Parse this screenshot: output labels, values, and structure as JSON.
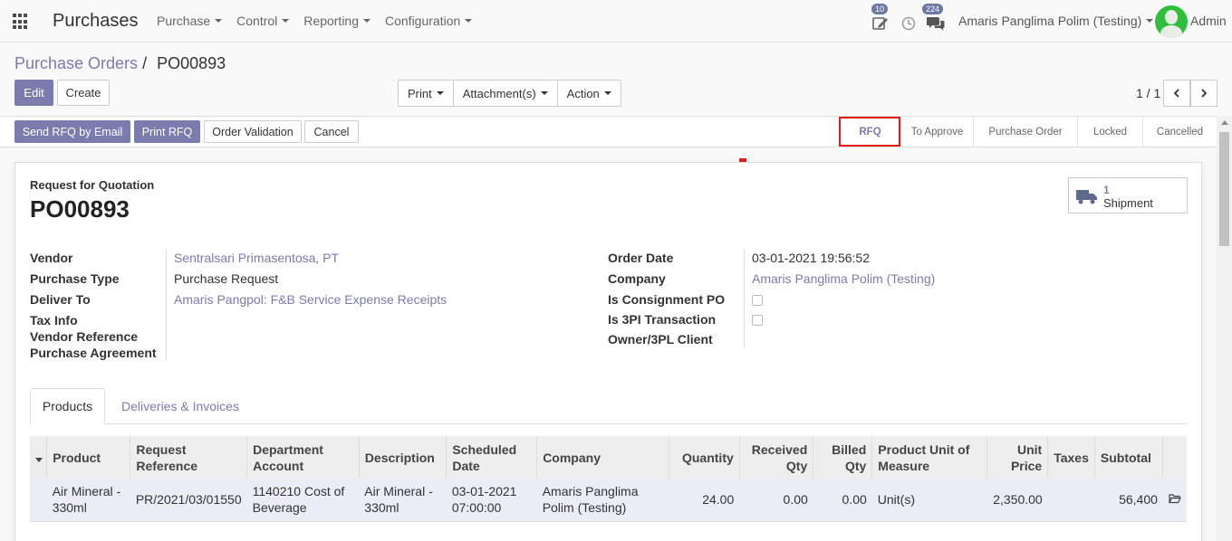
{
  "navbar": {
    "app_title": "Purchases",
    "menus": [
      "Purchase",
      "Control",
      "Reporting",
      "Configuration"
    ],
    "activity_badge": "10",
    "messages_badge": "224",
    "company": "Amaris Panglima Polim (Testing)",
    "user": "Admin"
  },
  "breadcrumb": {
    "parent": "Purchase Orders",
    "separator": "/",
    "current": "PO00893"
  },
  "buttons": {
    "edit": "Edit",
    "create": "Create",
    "print": "Print",
    "attachments": "Attachment(s)",
    "action": "Action"
  },
  "pager": {
    "value": "1 / 1"
  },
  "statusbar": {
    "send_rfq": "Send RFQ by Email",
    "print_rfq": "Print RFQ",
    "order_validation": "Order Validation",
    "cancel": "Cancel",
    "steps": [
      "RFQ",
      "To Approve",
      "Purchase Order",
      "Locked",
      "Cancelled"
    ],
    "active_step": "RFQ"
  },
  "form": {
    "doc_type": "Request for Quotation",
    "name": "PO00893",
    "shipment_count": "1",
    "shipment_label": "Shipment",
    "left_fields": [
      {
        "label": "Vendor",
        "value": "Sentralsari Primasentosa, PT"
      },
      {
        "label": "Purchase Type",
        "value": "Purchase Request"
      },
      {
        "label": "Deliver To",
        "value": "Amaris Pangpol: F&B Service Expense Receipts"
      },
      {
        "label": "Tax Info",
        "value": ""
      },
      {
        "label": "Vendor Reference",
        "value": ""
      },
      {
        "label": "Purchase Agreement",
        "value": ""
      }
    ],
    "right_fields": [
      {
        "label": "Order Date",
        "value": "03-01-2021 19:56:52"
      },
      {
        "label": "Company",
        "value": "Amaris Panglima Polim (Testing)"
      },
      {
        "label": "Is Consignment PO",
        "value": ""
      },
      {
        "label": "Is 3PI Transaction",
        "value": ""
      },
      {
        "label": "Owner/3PL Client",
        "value": ""
      }
    ],
    "is_consignment": false,
    "is_3pi": false
  },
  "tabs": [
    "Products",
    "Deliveries & Invoices"
  ],
  "lines": {
    "headers": [
      "Product",
      "Request Reference",
      "Department Account",
      "Description",
      "Scheduled Date",
      "Company",
      "Quantity",
      "Received Qty",
      "Billed Qty",
      "Product Unit of Measure",
      "Unit Price",
      "Taxes",
      "Subtotal"
    ],
    "rows": [
      {
        "product": "Air Mineral - 330ml",
        "request_ref": "PR/2021/03/01550",
        "dept_account": "1140210 Cost of Beverage",
        "description": "Air Mineral - 330ml",
        "scheduled": "03-01-2021 07:00:00",
        "company": "Amaris Panglima Polim (Testing)",
        "quantity": "24.00",
        "received": "0.00",
        "billed": "0.00",
        "uom": "Unit(s)",
        "unit_price": "2,350.00",
        "taxes": "",
        "subtotal": "56,400"
      }
    ]
  }
}
